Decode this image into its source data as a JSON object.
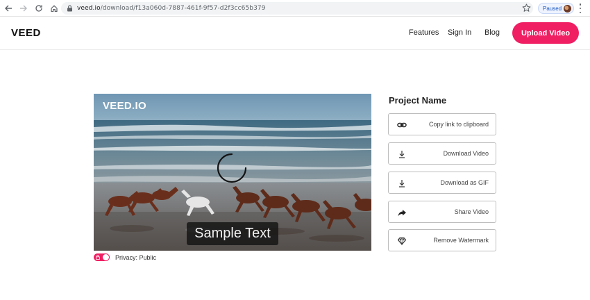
{
  "browser": {
    "url_domain": "veed.io",
    "url_path": "/download/f13a060d-7887-461f-9f57-d2f3cc65b379",
    "profile_status": "Paused"
  },
  "header": {
    "logo": "VEED",
    "nav": [
      "Features",
      "Sign In",
      "Blog"
    ],
    "cta_label": "Upload Video"
  },
  "video": {
    "watermark": "VEED.IO",
    "caption": "Sample Text"
  },
  "privacy": {
    "label": "Privacy: Public",
    "enabled": true
  },
  "project": {
    "title": "Project Name",
    "actions": [
      {
        "label": "Copy link to clipboard",
        "icon": "link-icon"
      },
      {
        "label": "Download Video",
        "icon": "download-icon"
      },
      {
        "label": "Download as GIF",
        "icon": "download-icon"
      },
      {
        "label": "Share Video",
        "icon": "share-arrow-icon"
      },
      {
        "label": "Remove Watermark",
        "icon": "diamond-icon"
      }
    ]
  },
  "colors": {
    "accent": "#f01e63",
    "text": "#1f1f1f",
    "border": "#bdbdbd"
  }
}
